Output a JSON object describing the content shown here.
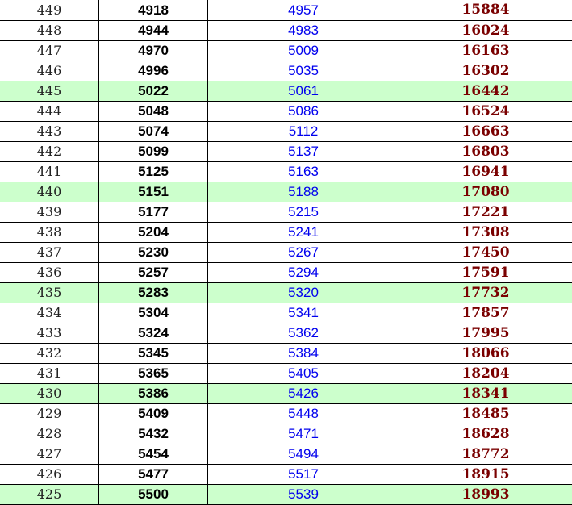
{
  "table": {
    "rows": [
      {
        "score": "449",
        "a": "4918",
        "b": "4957",
        "c": "15884",
        "highlight": false
      },
      {
        "score": "448",
        "a": "4944",
        "b": "4983",
        "c": "16024",
        "highlight": false
      },
      {
        "score": "447",
        "a": "4970",
        "b": "5009",
        "c": "16163",
        "highlight": false
      },
      {
        "score": "446",
        "a": "4996",
        "b": "5035",
        "c": "16302",
        "highlight": false
      },
      {
        "score": "445",
        "a": "5022",
        "b": "5061",
        "c": "16442",
        "highlight": true
      },
      {
        "score": "444",
        "a": "5048",
        "b": "5086",
        "c": "16524",
        "highlight": false
      },
      {
        "score": "443",
        "a": "5074",
        "b": "5112",
        "c": "16663",
        "highlight": false
      },
      {
        "score": "442",
        "a": "5099",
        "b": "5137",
        "c": "16803",
        "highlight": false
      },
      {
        "score": "441",
        "a": "5125",
        "b": "5163",
        "c": "16941",
        "highlight": false
      },
      {
        "score": "440",
        "a": "5151",
        "b": "5188",
        "c": "17080",
        "highlight": true
      },
      {
        "score": "439",
        "a": "5177",
        "b": "5215",
        "c": "17221",
        "highlight": false
      },
      {
        "score": "438",
        "a": "5204",
        "b": "5241",
        "c": "17308",
        "highlight": false
      },
      {
        "score": "437",
        "a": "5230",
        "b": "5267",
        "c": "17450",
        "highlight": false
      },
      {
        "score": "436",
        "a": "5257",
        "b": "5294",
        "c": "17591",
        "highlight": false
      },
      {
        "score": "435",
        "a": "5283",
        "b": "5320",
        "c": "17732",
        "highlight": true
      },
      {
        "score": "434",
        "a": "5304",
        "b": "5341",
        "c": "17857",
        "highlight": false
      },
      {
        "score": "433",
        "a": "5324",
        "b": "5362",
        "c": "17995",
        "highlight": false
      },
      {
        "score": "432",
        "a": "5345",
        "b": "5384",
        "c": "18066",
        "highlight": false
      },
      {
        "score": "431",
        "a": "5365",
        "b": "5405",
        "c": "18204",
        "highlight": false
      },
      {
        "score": "430",
        "a": "5386",
        "b": "5426",
        "c": "18341",
        "highlight": true
      },
      {
        "score": "429",
        "a": "5409",
        "b": "5448",
        "c": "18485",
        "highlight": false
      },
      {
        "score": "428",
        "a": "5432",
        "b": "5471",
        "c": "18628",
        "highlight": false
      },
      {
        "score": "427",
        "a": "5454",
        "b": "5494",
        "c": "18772",
        "highlight": false
      },
      {
        "score": "426",
        "a": "5477",
        "b": "5517",
        "c": "18915",
        "highlight": false
      },
      {
        "score": "425",
        "a": "5500",
        "b": "5539",
        "c": "18993",
        "highlight": true
      }
    ]
  },
  "colors": {
    "highlight_row": "#ccffcc",
    "column_a_text": "#000000",
    "column_b_text": "#0000ee",
    "column_c_text": "#7a0000",
    "grid_lines": "#000000"
  }
}
